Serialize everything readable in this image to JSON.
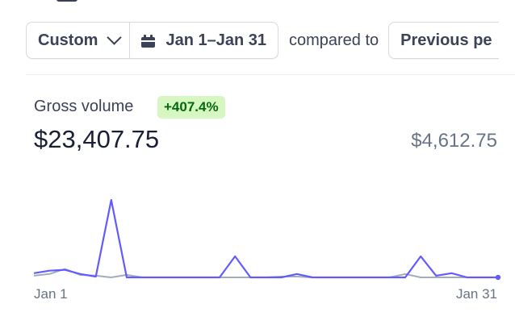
{
  "filters": {
    "range_preset": "Custom",
    "date_range": "Jan 1–Jan 31",
    "compared_to_label": "compared to",
    "comparison_option": "Previous pe"
  },
  "metric": {
    "label": "Gross volume",
    "change_badge": "+407.4%",
    "value": "$23,407.75",
    "comparison_value": "$4,612.75"
  },
  "colors": {
    "current_series": "#635bff",
    "previous_series": "#a3acb9",
    "badge_bg": "#d7f7c2",
    "badge_text": "#05690d"
  },
  "icons": {
    "range_dropdown": "chevron-down-icon",
    "date_picker": "calendar-icon"
  },
  "chart_data": {
    "type": "line",
    "x_start_label": "Jan 1",
    "x_end_label": "Jan 31",
    "x": [
      "Jan 1",
      "Jan 2",
      "Jan 3",
      "Jan 4",
      "Jan 5",
      "Jan 6",
      "Jan 7",
      "Jan 8",
      "Jan 9",
      "Jan 10",
      "Jan 11",
      "Jan 12",
      "Jan 13",
      "Jan 14",
      "Jan 15",
      "Jan 16",
      "Jan 17",
      "Jan 18",
      "Jan 19",
      "Jan 20",
      "Jan 21",
      "Jan 22",
      "Jan 23",
      "Jan 24",
      "Jan 25",
      "Jan 26",
      "Jan 27",
      "Jan 28",
      "Jan 29",
      "Jan 30",
      "Jan 31"
    ],
    "series": [
      {
        "values": [
          500,
          800,
          900,
          400,
          100,
          9200,
          0,
          0,
          0,
          0,
          0,
          0,
          0,
          2500,
          0,
          0,
          0,
          400,
          0,
          0,
          0,
          0,
          0,
          0,
          0,
          2500,
          200,
          500,
          0,
          0,
          0
        ]
      },
      {
        "values": [
          200,
          400,
          1000,
          300,
          200,
          0,
          300,
          0,
          0,
          0,
          0,
          0,
          0,
          0,
          0,
          0,
          100,
          100,
          0,
          0,
          0,
          0,
          0,
          0,
          400,
          0,
          0,
          0,
          0,
          0,
          0
        ]
      }
    ],
    "ylim": [
      0,
      10000
    ],
    "grid": false,
    "legend": "none"
  }
}
